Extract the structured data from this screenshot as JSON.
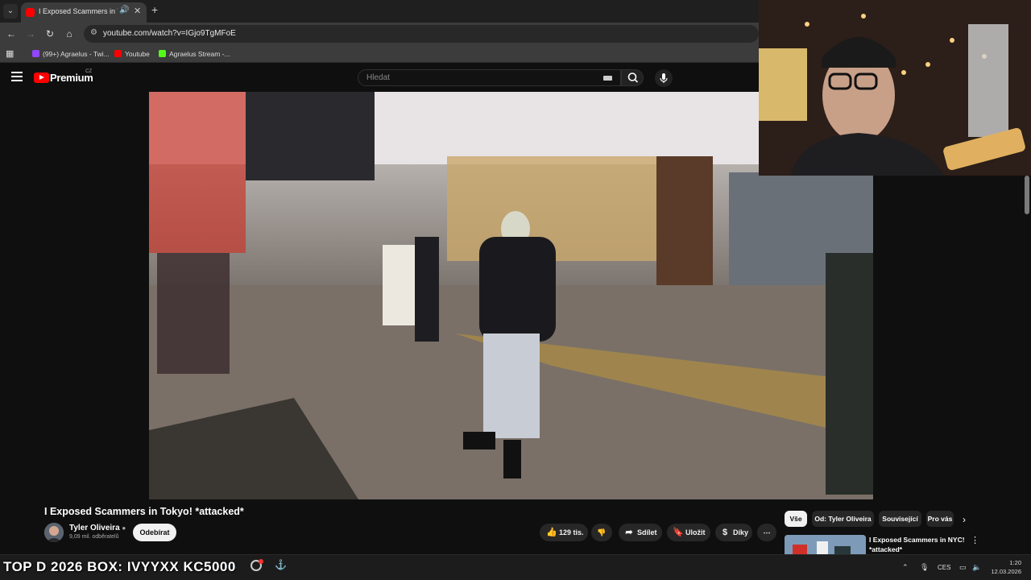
{
  "browser": {
    "tab_title": "I Exposed Scammers in Tokyo! *attacked*",
    "url": "youtube.com/watch?v=IGjo9TgMFoE",
    "bookmarks": [
      {
        "label": "(99+) Agraelus - Twi...",
        "color": "#9146ff"
      },
      {
        "label": "Youtube",
        "color": "#ff0000"
      },
      {
        "label": "Agraelus Stream -...",
        "color": "#53fc18"
      }
    ]
  },
  "youtube": {
    "logo_text": "Premium",
    "country_code": "CZ",
    "search_placeholder": "Hledat"
  },
  "video": {
    "title": "I Exposed Scammers in Tokyo! *attacked*",
    "channel_name": "Tyler Oliveira",
    "subscribers": "9,09 mil. odběratelů",
    "subscribe_label": "Odebírat",
    "likes": "129 tis.",
    "share_label": "Sdílet",
    "save_label": "Uložit",
    "thanks_label": "Díky"
  },
  "chips": [
    "Vše",
    "Od: Tyler Oliveira",
    "Související",
    "Pro vás"
  ],
  "recommendation": {
    "title": "I Exposed Scammers in NYC! *attacked*"
  },
  "overlay": {
    "promo_text": "TOP D 2026 BOX: IVYYXX KC5000"
  },
  "taskbar": {
    "language": "CES",
    "time": "1:20",
    "date": "12.03.2026"
  }
}
